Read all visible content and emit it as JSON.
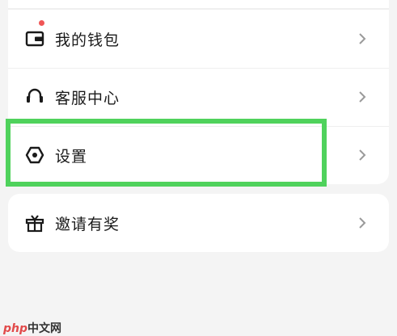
{
  "menu": {
    "items": [
      {
        "id": "wallet",
        "label": "我的钱包",
        "icon": "wallet-icon",
        "has_badge": true
      },
      {
        "id": "support",
        "label": "客服中心",
        "icon": "headset-icon",
        "has_badge": false
      },
      {
        "id": "settings",
        "label": "设置",
        "icon": "hexagon-settings-icon",
        "has_badge": false
      }
    ],
    "invite": {
      "label": "邀请有奖",
      "icon": "gift-icon"
    }
  },
  "highlight": {
    "target": "settings",
    "color": "#4fd25c"
  },
  "badge_color": "#f05656",
  "watermark": {
    "prefix": "php",
    "suffix": "中文网"
  }
}
